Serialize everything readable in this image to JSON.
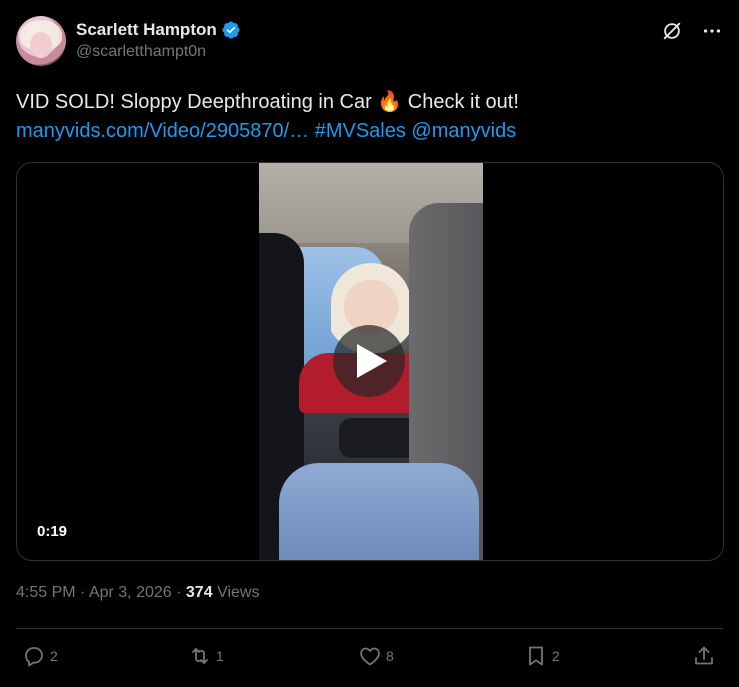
{
  "author": {
    "display_name": "Scarlett Hampton",
    "handle": "@scarletthampt0n",
    "verified": true,
    "verified_color": "#1d9bf0"
  },
  "icons": {
    "top_right": [
      "grok-icon",
      "more-icon"
    ],
    "actions": [
      "reply-icon",
      "retweet-icon",
      "like-icon",
      "bookmark-icon",
      "share-icon"
    ]
  },
  "tweet": {
    "text_line1": "VID SOLD! Sloppy Deepthroating in Car 🔥 Check it out!",
    "link_url": "manyvids.com/Video/2905870/…",
    "hashtag": "#MVSales",
    "mention": "@manyvids",
    "link_color": "#1d9bf0"
  },
  "media": {
    "duration": "0:19"
  },
  "meta": {
    "time": "4:55 PM",
    "separator": "·",
    "date": "Apr 3, 2026",
    "views_count": "374",
    "views_label": "Views"
  },
  "actions": {
    "replies": "2",
    "retweets": "1",
    "likes": "8",
    "bookmarks": "2"
  }
}
